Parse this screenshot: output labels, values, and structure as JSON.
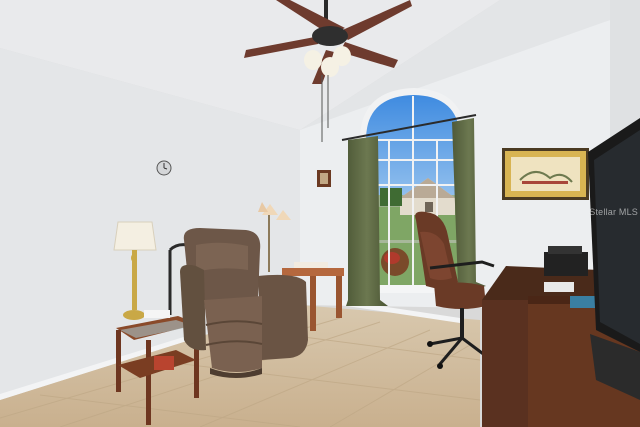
{
  "photo": {
    "subject": "",
    "watermark_text": "Stellar MLS"
  },
  "palette": {
    "wall": "#e6e8ea",
    "ceiling": "#e9eaec",
    "floor": "#d4c0a4",
    "curtain": "#5f6a45",
    "recliner": "#6d5748",
    "desk": "#5a3120",
    "office_chair": "#6a3a26"
  }
}
